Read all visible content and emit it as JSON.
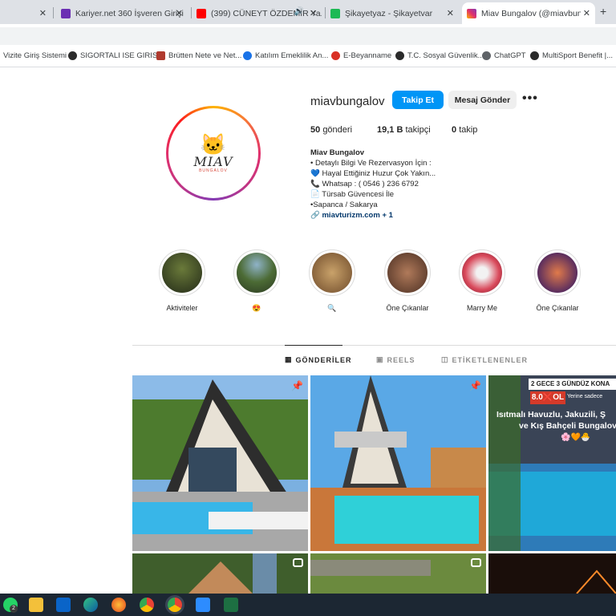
{
  "browser": {
    "tabs": [
      {
        "label": "",
        "favicon_color": "#9aa0a6"
      },
      {
        "label": "Kariyer.net 360 İşveren Girişi",
        "favicon_color": "#6b2fb3"
      },
      {
        "label": "(399) CÜNEYT ÖZDEMİR Ya...",
        "favicon_color": "#ff0000"
      },
      {
        "label": "Şikayetyaz - Şikayetvar",
        "favicon_color": "#1db954"
      },
      {
        "label": "Miav Bungalov (@miavbungalov",
        "favicon_color": "#e1306c"
      }
    ],
    "close_glyph": "✕",
    "new_tab_glyph": "+",
    "bookmarks": [
      {
        "label": "Vizite Giriş Sistemi",
        "icon_color": ""
      },
      {
        "label": "SIGORTALI ISE GIRIS...",
        "icon_color": "#2b2b2b"
      },
      {
        "label": "Brütten Nete ve Net...",
        "icon_color": "#b03a2e"
      },
      {
        "label": "Katılım Emeklilik An...",
        "icon_color": "#1a73e8"
      },
      {
        "label": "E-Beyanname",
        "icon_color": "#d93025"
      },
      {
        "label": "T.C. Sosyal Güvenlik...",
        "icon_color": "#2b2b2b"
      },
      {
        "label": "ChatGPT",
        "icon_color": "#5f6368"
      },
      {
        "label": "MultiSport Benefit |...",
        "icon_color": "#2b2b2b"
      }
    ]
  },
  "profile": {
    "username": "miavbungalov",
    "follow_label": "Takip Et",
    "message_label": "Mesaj Gönder",
    "more_glyph": "•••",
    "avatar": {
      "cat_glyph": "🐱",
      "wordmark": "MIAV",
      "subtext": "BUNGALOV"
    },
    "stats": [
      {
        "count": "50",
        "label": "gönderi"
      },
      {
        "count": "19,1 B",
        "label": "takipçi"
      },
      {
        "count": "0",
        "label": "takip"
      }
    ],
    "bio": {
      "name": "Miav Bungalov",
      "lines": [
        "• Detaylı Bilgi Ve Rezervasyon İçin :",
        "💙 Hayal Ettiğiniz Huzur Çok Yakın...",
        "📞 Whatsap : ( 0546 ) 236 6792",
        "📄 Türsab Güvencesi İle",
        "•Sapanca / Sakarya"
      ],
      "link_icon": "🔗",
      "link": "miavturizm.com + 1"
    }
  },
  "highlights": [
    {
      "label": "Aktiviteler",
      "color": "#2f3a24"
    },
    {
      "label": "😍",
      "color": "#4f6b3a"
    },
    {
      "label": "🔍",
      "color": "#8a6a3e"
    },
    {
      "label": "Öne Çıkanlar",
      "color": "#6d4a35"
    },
    {
      "label": "Marry Me",
      "color": "#c9485b"
    },
    {
      "label": "Öne Çıkanlar",
      "color": "#5a3d6a"
    }
  ],
  "post_tabs": [
    {
      "label": "GÖNDERİLER",
      "icon": "▦",
      "active": true
    },
    {
      "label": "REELS",
      "icon": "▣",
      "active": false
    },
    {
      "label": "ETİKETLENENLER",
      "icon": "◫",
      "active": false
    }
  ],
  "posts": {
    "third_text": {
      "badge_top": "2 GECE 3 GÜNDÜZ KONA",
      "price": "8.0",
      "price_mark": "❌",
      "price_tail": "OL",
      "sub": "Yerine sadece",
      "line1": "Isıtmalı Havuzlu, Jakuzili, Ş",
      "line2": "ve Kış Bahçeli Bungalov Ö",
      "emoji": "🌸🧡🐣"
    }
  },
  "taskbar": {
    "badge": "2",
    "icons": [
      "whatsapp",
      "file-explorer",
      "outlook",
      "edge",
      "firefox",
      "chrome",
      "chrome-active",
      "zoom",
      "excel"
    ]
  }
}
